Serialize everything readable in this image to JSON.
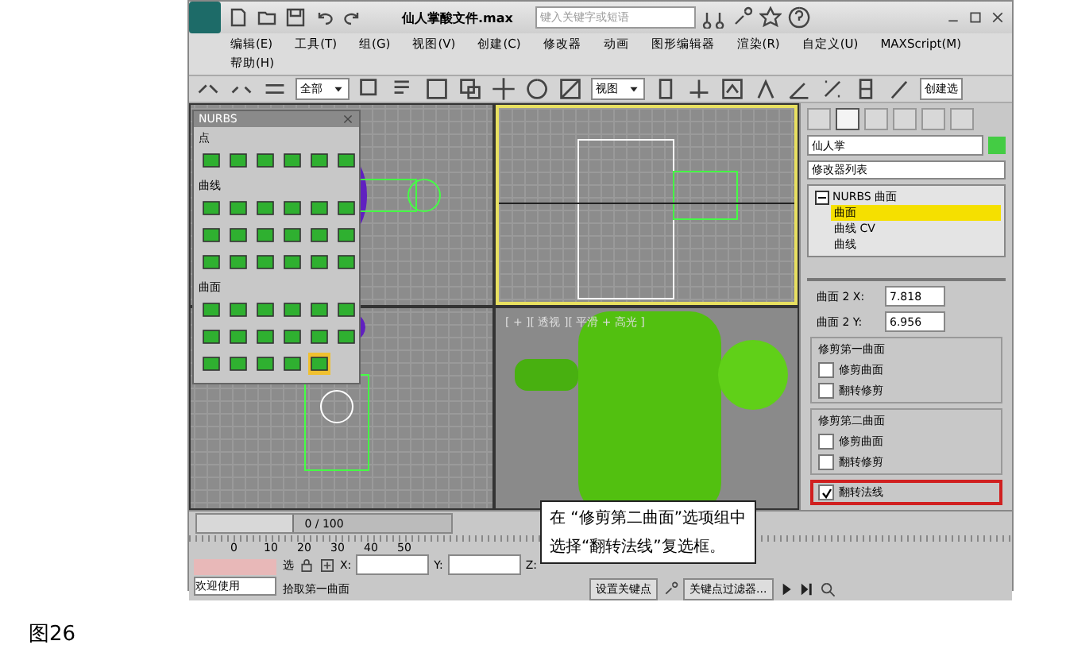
{
  "window": {
    "title": "仙人掌酸文件.max",
    "search": {
      "placeholder": "键入关键字或短语"
    }
  },
  "menu": [
    "编辑(E)",
    "工具(T)",
    "组(G)",
    "视图(V)",
    "创建(C)",
    "修改器",
    "动画",
    "图形编辑器",
    "渲染(R)",
    "自定义(U)",
    "MAXScript(M)",
    "帮助(H)"
  ],
  "toolbar": {
    "selection_filter": "全部",
    "coordinate_system": "视图",
    "named_selection": "创建选"
  },
  "nurbs_panel": {
    "title": "NURBS",
    "sections": [
      {
        "label": "点",
        "tools": [
          {
            "selected": false
          },
          {
            "selected": false
          },
          {
            "selected": false
          },
          {
            "selected": false
          },
          {
            "selected": false
          },
          {
            "selected": false
          }
        ]
      },
      {
        "label": "曲线",
        "tools": [
          {
            "selected": false
          },
          {
            "selected": false
          },
          {
            "selected": false
          },
          {
            "selected": false
          },
          {
            "selected": false
          },
          {
            "selected": false
          },
          {
            "selected": false
          },
          {
            "selected": false
          },
          {
            "selected": false
          },
          {
            "selected": false
          },
          {
            "selected": false
          },
          {
            "selected": false
          },
          {
            "selected": false
          },
          {
            "selected": false
          },
          {
            "selected": false
          },
          {
            "selected": false
          },
          {
            "selected": false
          },
          {
            "selected": false
          }
        ]
      },
      {
        "label": "曲面",
        "tools": [
          {
            "selected": false
          },
          {
            "selected": false
          },
          {
            "selected": false
          },
          {
            "selected": false
          },
          {
            "selected": false
          },
          {
            "selected": false
          },
          {
            "selected": false
          },
          {
            "selected": false
          },
          {
            "selected": false
          },
          {
            "selected": false
          },
          {
            "selected": false
          },
          {
            "selected": false
          },
          {
            "selected": false
          },
          {
            "selected": false
          },
          {
            "selected": false
          },
          {
            "selected": false
          },
          {
            "selected": true
          }
        ]
      }
    ]
  },
  "viewports": [
    {
      "kind": "top",
      "selected": false
    },
    {
      "kind": "front",
      "selected": true
    },
    {
      "kind": "left",
      "selected": false
    },
    {
      "kind": "perspective",
      "selected": false,
      "label": "[ + ][ 透视 ][ 平滑 + 高光 ]"
    }
  ],
  "command_panel": {
    "tabs": [
      {
        "selected": false
      },
      {
        "selected": true
      },
      {
        "selected": false
      },
      {
        "selected": false
      },
      {
        "selected": false
      },
      {
        "selected": false
      }
    ],
    "object_name": "仙人掌",
    "modifier_list": "修改器列表",
    "stack": [
      {
        "label": "NURBS 曲面",
        "expanded": true,
        "selected": false,
        "children": [
          {
            "label": "曲面",
            "selected": true
          },
          {
            "label": "曲线 CV",
            "selected": false
          },
          {
            "label": "曲线",
            "selected": false
          }
        ]
      }
    ],
    "params": [
      {
        "label": "曲面 2 X:",
        "value": "7.818"
      },
      {
        "label": "曲面 2 Y:",
        "value": "6.956"
      }
    ],
    "groups": [
      {
        "title": "修剪第一曲面",
        "options": [
          {
            "label": "修剪曲面",
            "checked": false
          },
          {
            "label": "翻转修剪",
            "checked": false
          }
        ]
      },
      {
        "title": "修剪第二曲面",
        "options": [
          {
            "label": "修剪曲面",
            "checked": false
          },
          {
            "label": "翻转修剪",
            "checked": false
          }
        ]
      }
    ],
    "flip_normals": {
      "label": "翻转法线",
      "checked": true,
      "highlighted": true
    }
  },
  "time_slider": {
    "text": "0 / 100",
    "level": 0
  },
  "timeline": {
    "ticks": [
      "0",
      "10",
      "20",
      "30",
      "40",
      "50"
    ]
  },
  "status_bar": {
    "welcome": "欢迎使用",
    "select_label": "选",
    "x_label": "X:",
    "y_label": "Y:",
    "z_label": "Z:",
    "prompt": "拾取第一曲面",
    "set_key": "设置关键点",
    "key_filters": "关键点过滤器..."
  },
  "callout": {
    "lines": [
      "在 “修剪第二曲面”选项组中",
      "选择“翻转法线”复选框。"
    ]
  },
  "caption": "图26"
}
